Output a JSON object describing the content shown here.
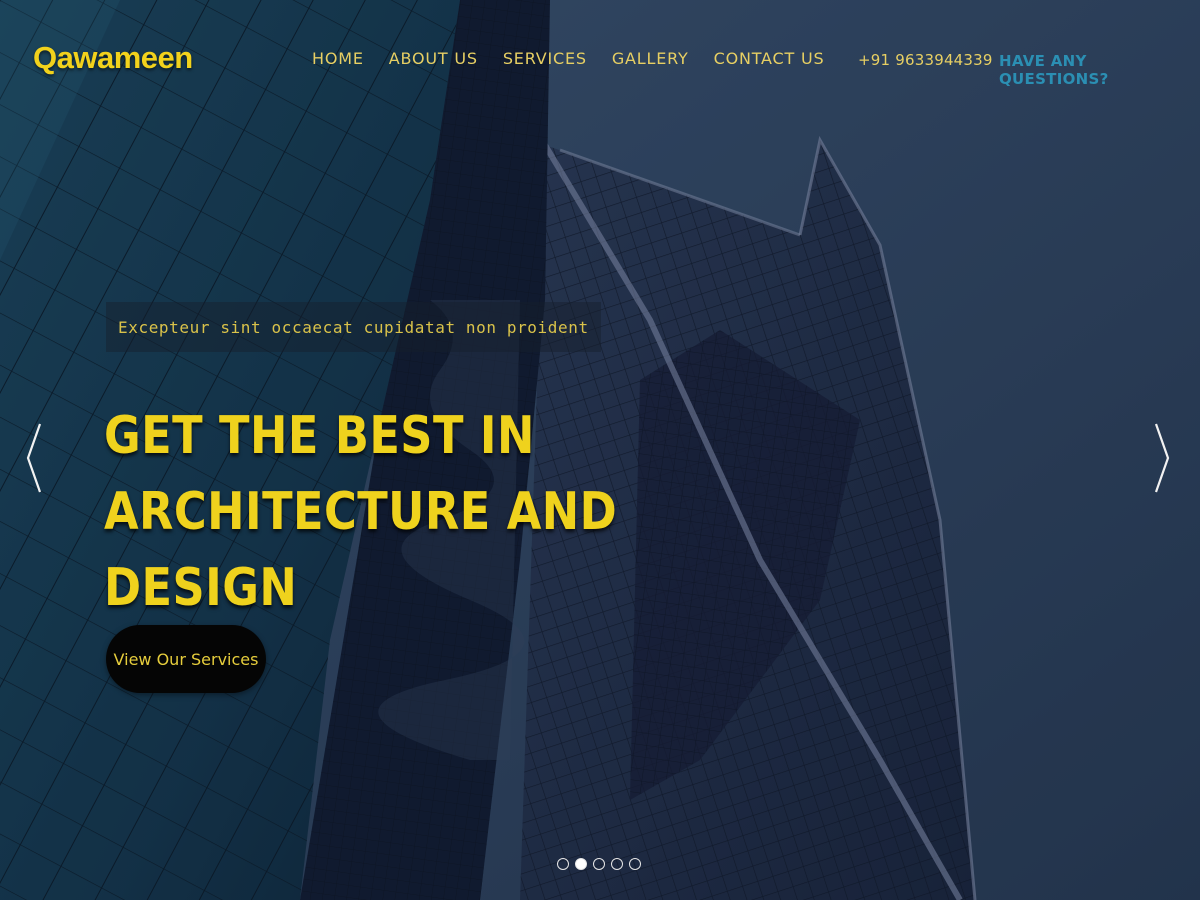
{
  "brand": {
    "logo_text": "Qawameen"
  },
  "nav": {
    "items": [
      {
        "label": "HOME"
      },
      {
        "label": "ABOUT US"
      },
      {
        "label": "SERVICES"
      },
      {
        "label": "GALLERY"
      },
      {
        "label": "CONTACT US"
      }
    ]
  },
  "header": {
    "phone": "+91 9633944339",
    "questions": "HAVE ANY QUESTIONS?"
  },
  "slide": {
    "tagline": "Excepteur sint occaecat cupidatat non proident",
    "headline_line1": "GET THE BEST IN ARCHITECTURE AND",
    "headline_line2": "DESIGN",
    "cta_label": "View Our Services"
  },
  "carousel": {
    "prev_icon": "chevron-left-icon",
    "next_icon": "chevron-right-icon",
    "slide_count": 5,
    "active_index": 1
  },
  "colors": {
    "accent_yellow": "#efd21d",
    "link_blue": "#2b8fb3",
    "cta_bg": "#050505",
    "sky": "#3c5575"
  }
}
